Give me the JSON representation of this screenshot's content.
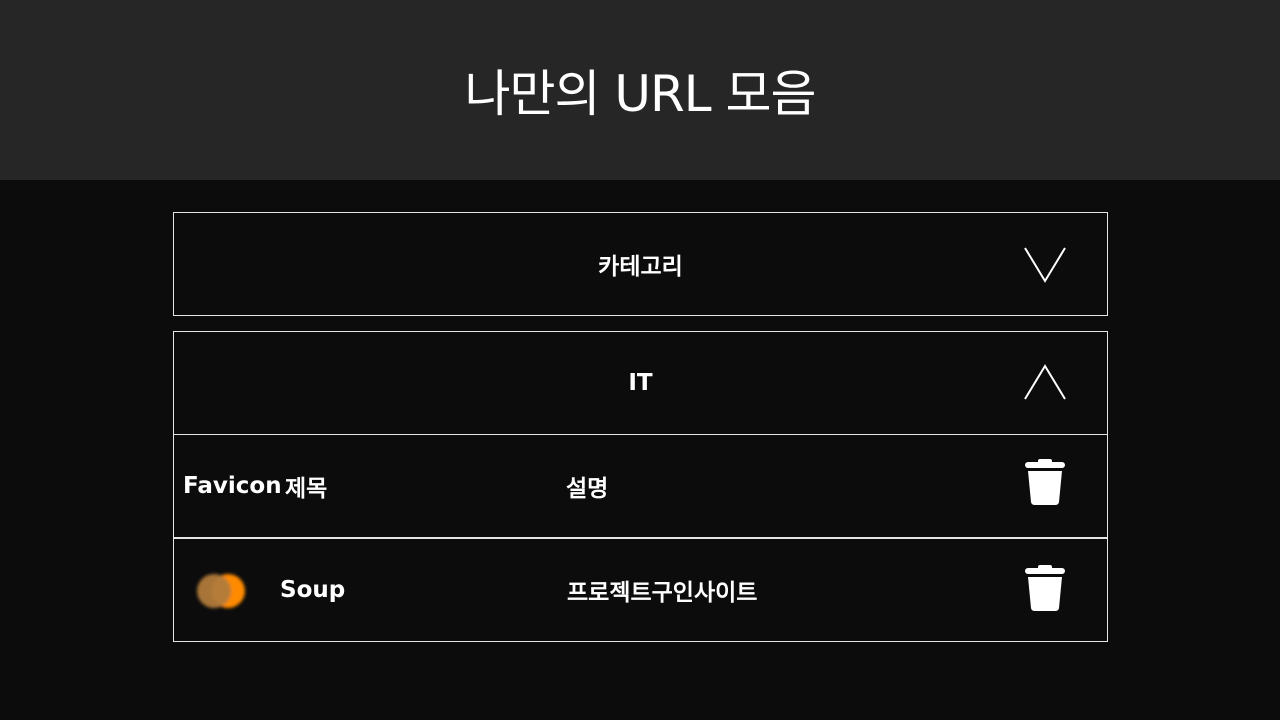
{
  "header": {
    "title": "나만의 URL 모음"
  },
  "category_selector": {
    "label": "카테고리",
    "toggle_icon": "chevron-down-icon"
  },
  "group": {
    "name": "IT",
    "toggle_icon": "chevron-up-icon",
    "columns": {
      "favicon": "Favicon",
      "title": "제목",
      "description": "설명"
    },
    "header_action_icon": "trash-icon",
    "items": [
      {
        "favicon_icon": "soup-favicon-icon",
        "title": "Soup",
        "description": "프로젝트구인사이트",
        "action_icon": "trash-icon"
      }
    ]
  },
  "colors": {
    "header_bg": "#262626",
    "page_bg": "#0c0c0c",
    "text": "#ffffff",
    "border": "#e6e6e6",
    "favicon_orange": "#ff8a00",
    "favicon_brown": "#b07a3a"
  }
}
